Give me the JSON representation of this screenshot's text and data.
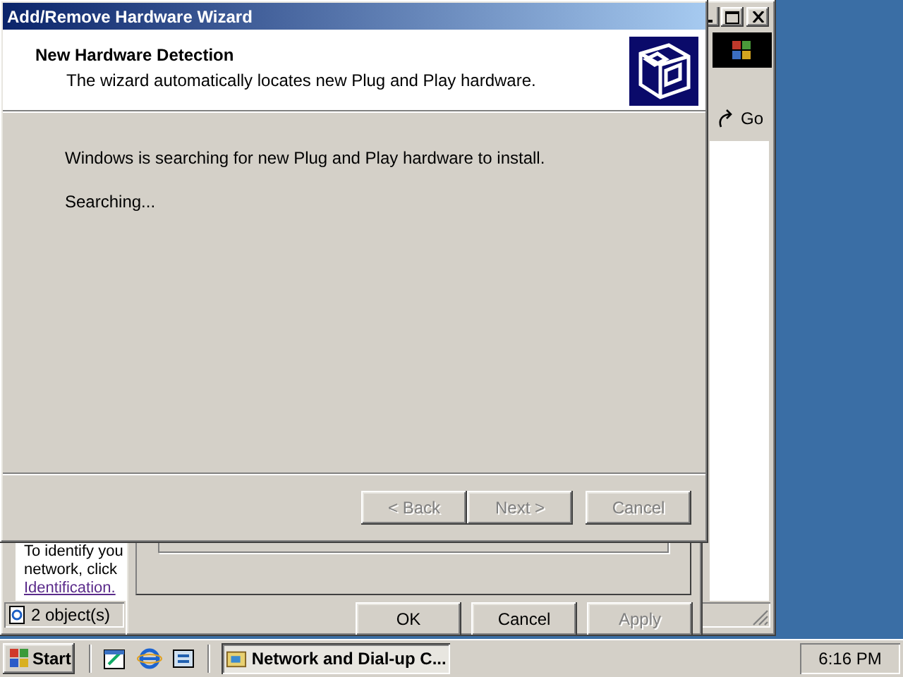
{
  "explorer": {
    "go_button": "Go",
    "info_lines": [
      "To identify you",
      "network, click"
    ],
    "info_link_2": "Identification.",
    "status": "2 object(s)"
  },
  "properties": {
    "buttons": [
      {
        "label": "OK",
        "disabled": false
      },
      {
        "label": "Cancel",
        "disabled": false
      },
      {
        "label": "Apply",
        "disabled": true
      }
    ]
  },
  "wizard": {
    "title": "Add/Remove Hardware Wizard",
    "header_title": "New Hardware Detection",
    "header_subtitle": "The wizard automatically locates new Plug and Play hardware.",
    "message": "Windows is searching for new Plug and Play hardware to install.",
    "status": "Searching...",
    "buttons": [
      {
        "label": "< Back",
        "disabled": true
      },
      {
        "label": "Next >",
        "disabled": true
      },
      {
        "label": "Cancel",
        "disabled": true
      }
    ]
  },
  "taskbar": {
    "start": "Start",
    "tasks": [
      {
        "label": "Network and Dial-up C...",
        "selected": true
      }
    ],
    "clock": "6:16 PM"
  }
}
